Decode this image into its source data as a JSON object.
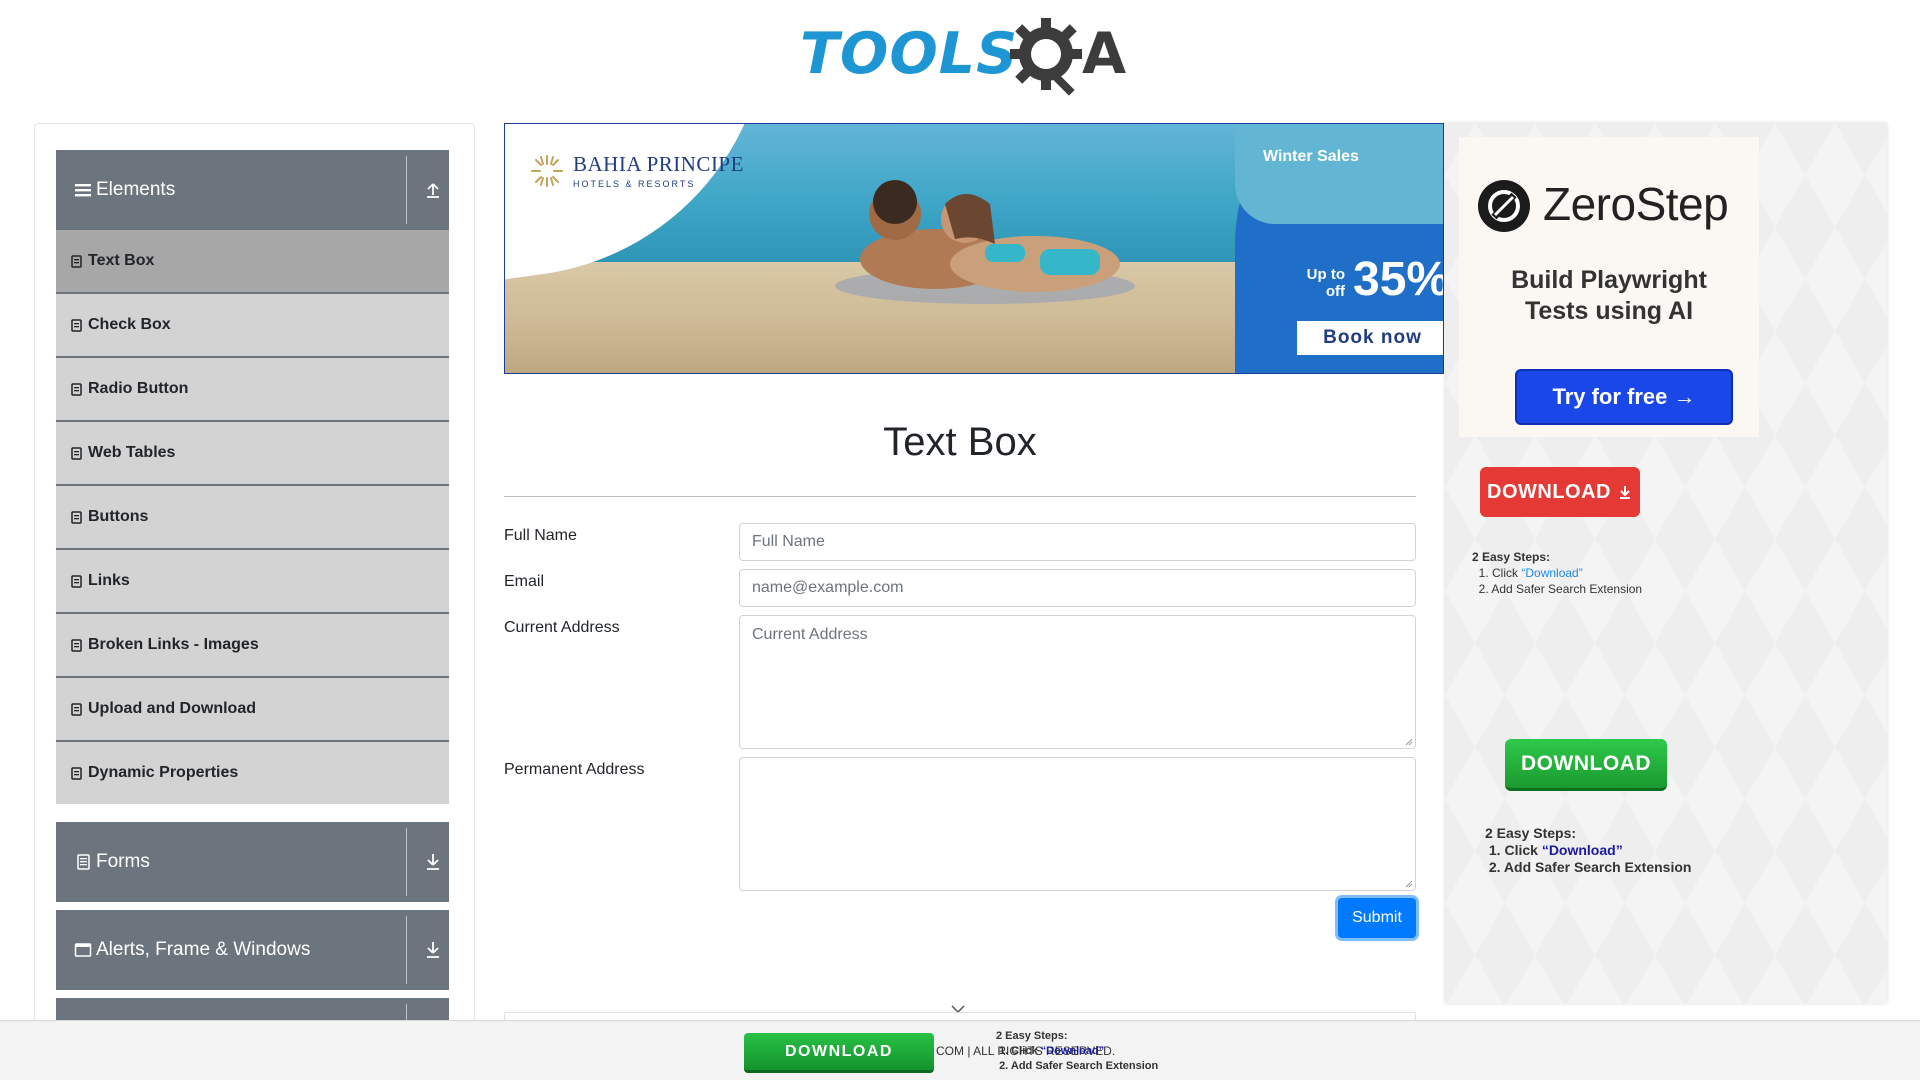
{
  "header": {
    "logo_text": "TOOLS",
    "logo_text_end": "A"
  },
  "sidebar": {
    "groups": [
      {
        "title": "Elements",
        "expanded": true,
        "items": [
          {
            "label": "Text Box",
            "active": true
          },
          {
            "label": "Check Box"
          },
          {
            "label": "Radio Button"
          },
          {
            "label": "Web Tables"
          },
          {
            "label": "Buttons"
          },
          {
            "label": "Links"
          },
          {
            "label": "Broken Links - Images"
          },
          {
            "label": "Upload and Download"
          },
          {
            "label": "Dynamic Properties"
          }
        ]
      },
      {
        "title": "Forms",
        "expanded": false
      },
      {
        "title": "Alerts, Frame & Windows",
        "expanded": false
      }
    ]
  },
  "banner": {
    "brand": "BAHIA PRINCIPE",
    "brand_sub": "HOTELS & RESORTS",
    "promo_title": "Winter Sales",
    "upto": "Up to",
    "off": "off",
    "percent": "35%",
    "cta": "Book now"
  },
  "main": {
    "title": "Text Box",
    "form": {
      "full_name_label": "Full Name",
      "full_name_placeholder": "Full Name",
      "email_label": "Email",
      "email_placeholder": "name@example.com",
      "current_address_label": "Current Address",
      "current_address_placeholder": "Current Address",
      "permanent_address_label": "Permanent Address",
      "permanent_address_placeholder": "",
      "submit_label": "Submit"
    }
  },
  "ads": {
    "zerostep": {
      "name": "ZeroStep",
      "headline_1": "Build Playwright",
      "headline_2": "Tests using AI",
      "cta": "Try for free →"
    },
    "download_red": {
      "label": "DOWNLOAD",
      "steps_title": "2 Easy Steps:",
      "step1_prefix": "1. Click ",
      "step1_link": "“Download”",
      "step2": "2. Add Safer Search Extension"
    },
    "download_green": {
      "label": "DOWNLOAD",
      "steps_title": "2 Easy Steps:",
      "step1_prefix": "1. Click ",
      "step1_link": "“Download”",
      "step2": "2. Add Safer Search Extension"
    }
  },
  "bottom_ad": {
    "download_label": "DOWNLOAD",
    "copyright_fragment": "COM | ALL RIGHTS RESERVED.",
    "steps_title": "2 Easy Steps:",
    "step1_prefix": "1. Click ",
    "step1_link": "“Download”",
    "step2": "2. Add Safer Search Extension"
  },
  "colors": {
    "accent_blue": "#007bff",
    "sidebar_group": "#6c757d",
    "sidebar_item": "#d3d3d3",
    "sidebar_item_active": "#a7a7a7",
    "logo_blue": "#1e96d4"
  }
}
